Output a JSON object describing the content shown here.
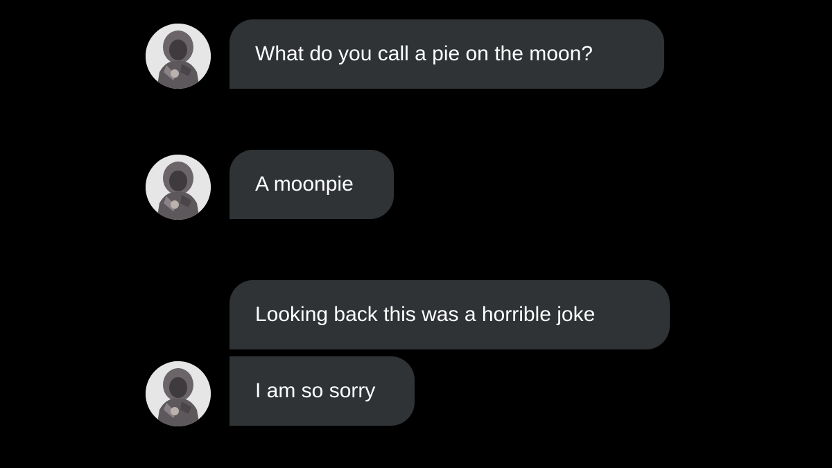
{
  "conversation": {
    "messages": [
      {
        "text": "What do you call a pie on the moon?",
        "avatar": "user-avatar"
      },
      {
        "text": "A moonpie",
        "avatar": "user-avatar"
      },
      {
        "text": "Looking back this was a horrible joke",
        "avatar": ""
      },
      {
        "text": "I am so sorry",
        "avatar": "user-avatar"
      }
    ]
  },
  "colors": {
    "background": "#000000",
    "bubble": "#2f3336",
    "text": "#ffffff",
    "avatar_background": "#e4e4e4"
  }
}
